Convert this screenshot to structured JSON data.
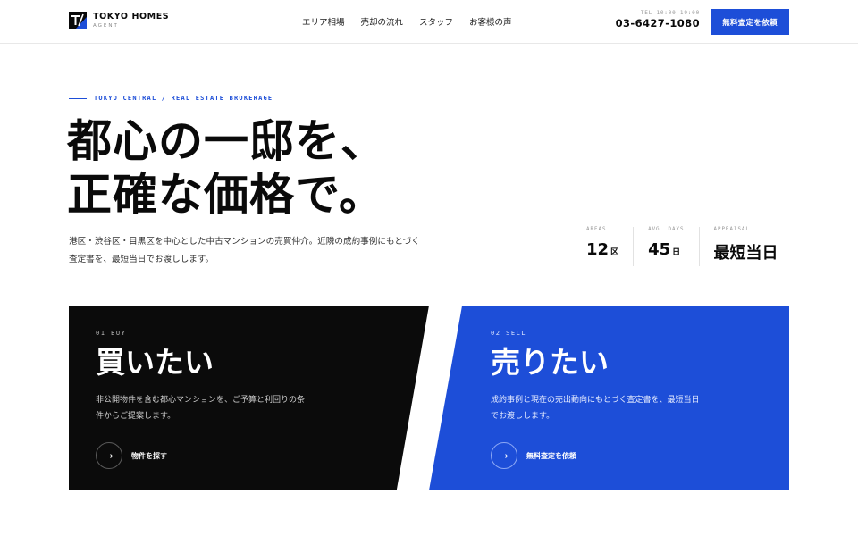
{
  "brand": {
    "name": "TOKYO HOMES",
    "sub": "AGENT",
    "mark_glyph": "T/"
  },
  "nav": {
    "items": [
      "エリア相場",
      "売却の流れ",
      "スタッフ",
      "お客様の声"
    ]
  },
  "contact": {
    "tel_label": "TEL 10:00-19:00",
    "tel_number": "03-6427-1080",
    "cta_label": "無料査定を依頼"
  },
  "hero": {
    "eyebrow": "TOKYO CENTRAL / REAL ESTATE BROKERAGE",
    "title_line1": "都心の一邸を、",
    "title_line2": "正確な価格で。",
    "description": "港区・渋谷区・目黒区を中心とした中古マンションの売買仲介。近隣の成約事例にもとづく査定書を、最短当日でお渡しします。"
  },
  "stats": [
    {
      "label": "AREAS",
      "value": "12",
      "unit": "区"
    },
    {
      "label": "AVG. DAYS",
      "value": "45",
      "unit": "日"
    },
    {
      "label": "APPRAISAL",
      "value": "最短当日",
      "unit": ""
    }
  ],
  "cards": {
    "buy": {
      "number": "01  BUY",
      "title": "買いたい",
      "description": "非公開物件を含む都心マンションを、ご予算と利回りの条件からご提案します。",
      "link_label": "物件を探す",
      "arrow": "→"
    },
    "sell": {
      "number": "02  SELL",
      "title": "売りたい",
      "description": "成約事例と現在の売出動向にもとづく査定書を、最短当日でお渡しします。",
      "link_label": "無料査定を依頼",
      "arrow": "→"
    }
  },
  "colors": {
    "accent": "#1d4ed8",
    "dark": "#0b0b0b",
    "text": "#0a0a0a"
  }
}
